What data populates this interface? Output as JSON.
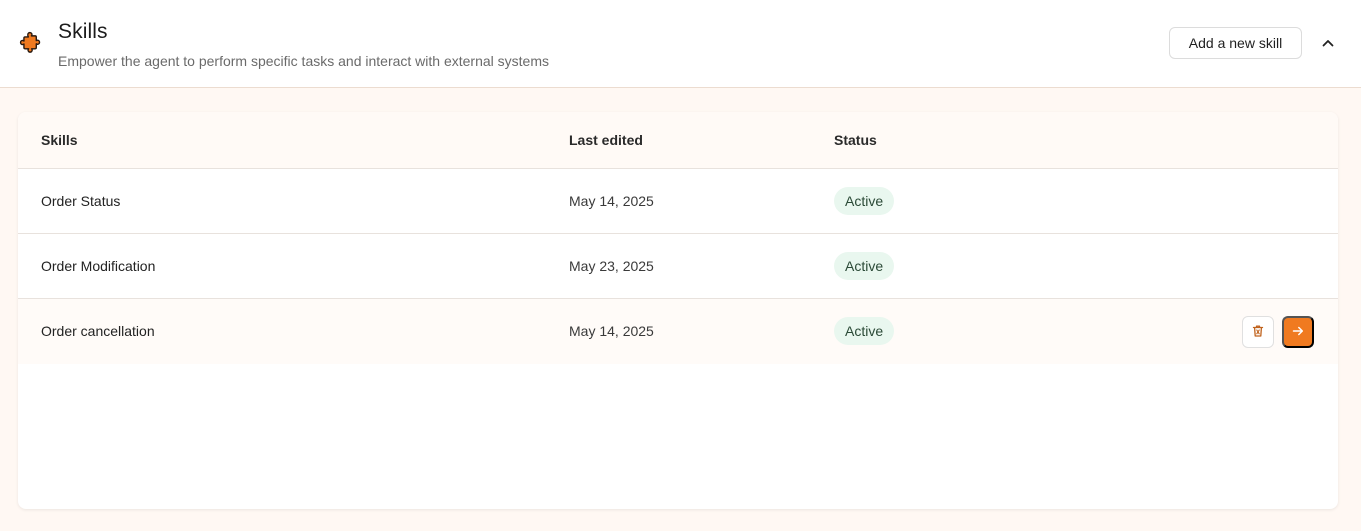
{
  "header": {
    "title": "Skills",
    "subtitle": "Empower the agent to perform specific tasks and interact with external systems",
    "add_button_label": "Add a new skill",
    "icon": "puzzle-icon",
    "collapse_icon": "chevron-up-icon",
    "accent_color": "#f07a20"
  },
  "table": {
    "columns": [
      "Skills",
      "Last edited",
      "Status"
    ],
    "rows": [
      {
        "skill": "Order Status",
        "last_edited": "May 14, 2025",
        "status": "Active"
      },
      {
        "skill": "Order Modification",
        "last_edited": "May 23, 2025",
        "status": "Active"
      },
      {
        "skill": "Order cancellation",
        "last_edited": "May 14, 2025",
        "status": "Active"
      }
    ],
    "row_actions": {
      "delete_icon": "trash-icon",
      "open_icon": "arrow-right-icon"
    },
    "status_badge_color": "#e9f7ef"
  }
}
